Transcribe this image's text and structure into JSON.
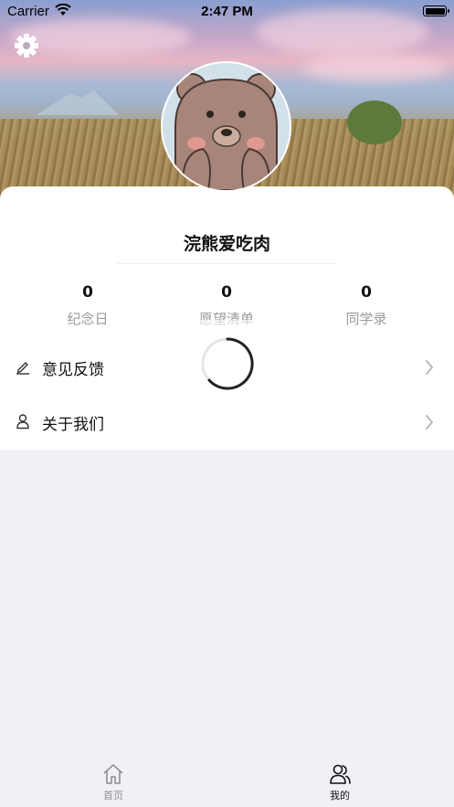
{
  "status_bar": {
    "carrier": "Carrier",
    "time": "2:47 PM"
  },
  "profile": {
    "username": "浣熊爱吃肉"
  },
  "stats": [
    {
      "value": "0",
      "label": "纪念日"
    },
    {
      "value": "0",
      "label": "愿望清单"
    },
    {
      "value": "0",
      "label": "同学录"
    }
  ],
  "menu": [
    {
      "label": "意见反馈",
      "icon": "pencil-icon"
    },
    {
      "label": "关于我们",
      "icon": "person-icon"
    }
  ],
  "tabbar": {
    "tabs": [
      {
        "label": "首页",
        "icon": "home-icon",
        "active": false
      },
      {
        "label": "我的",
        "icon": "users-icon",
        "active": true
      }
    ]
  },
  "colors": {
    "page_background": "#f1f0f5",
    "card_background": "#ffffff",
    "text_primary": "#111111",
    "text_secondary": "#9a9a9a",
    "tab_inactive": "#8e8e93",
    "avatar_background": "#d2e0ea",
    "bear_brown": "#a8857a"
  }
}
